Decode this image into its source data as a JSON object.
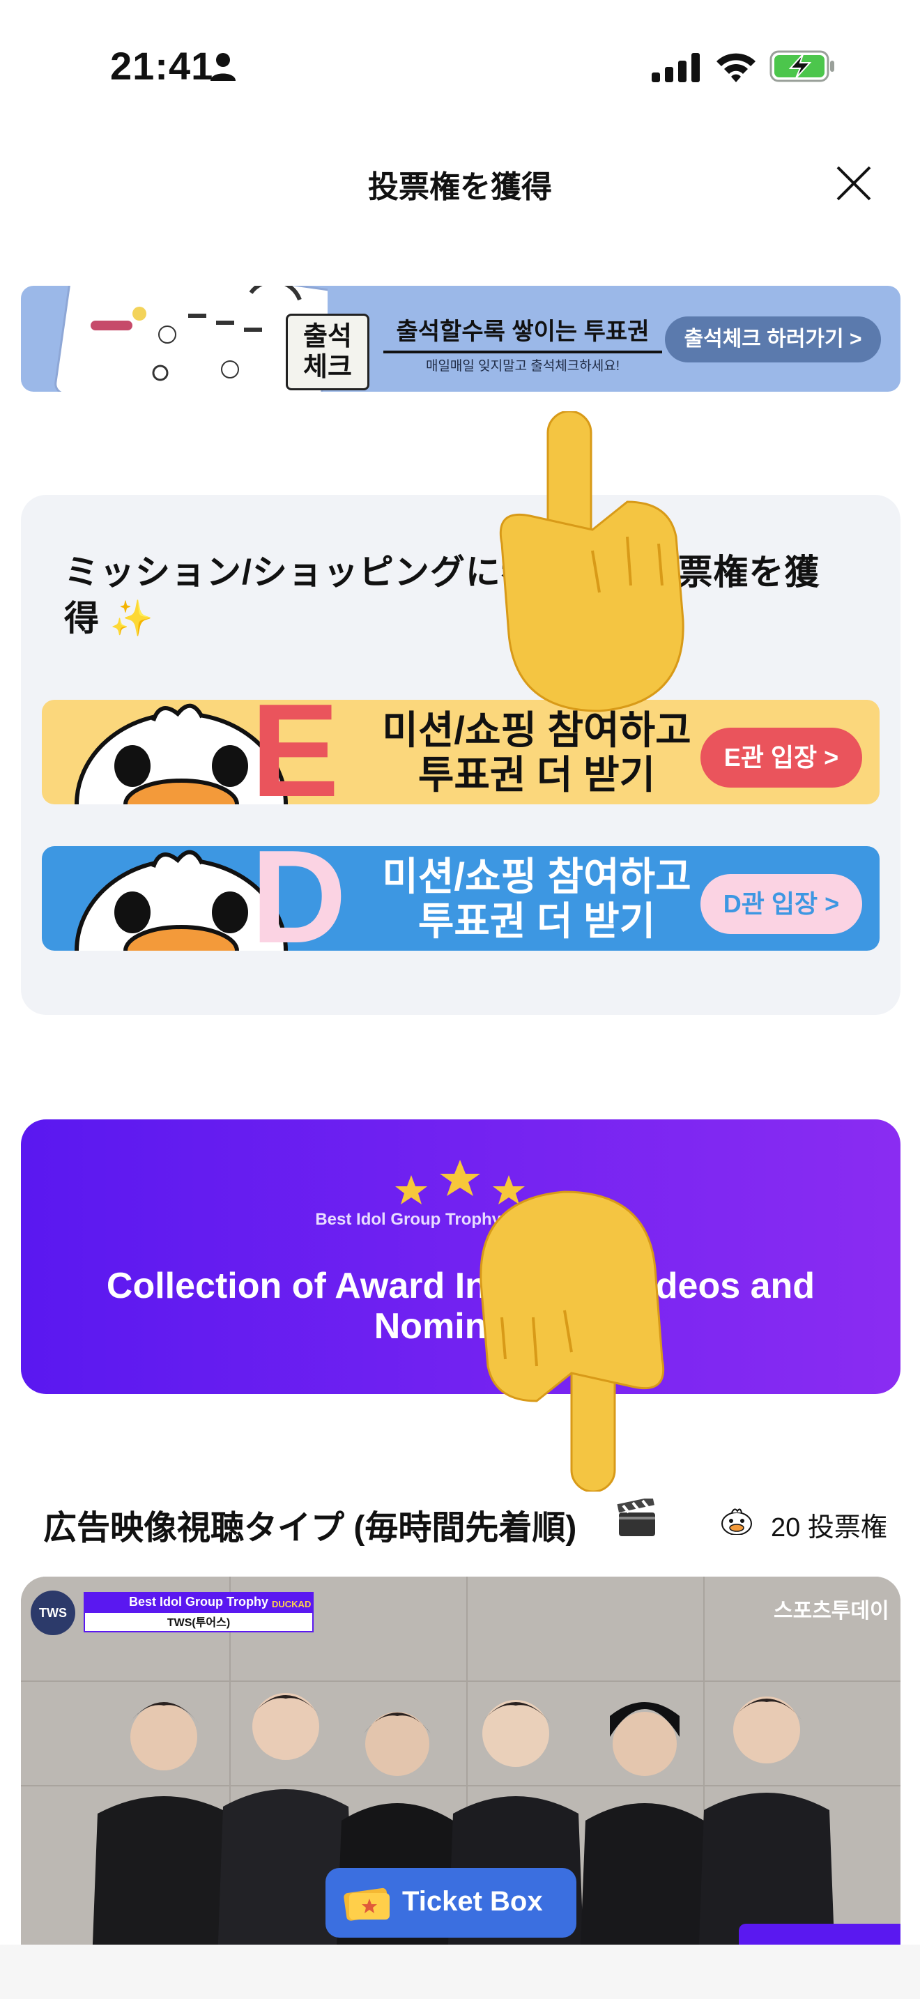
{
  "status_bar": {
    "time": "21:41"
  },
  "header": {
    "title": "投票権を獲得"
  },
  "attendance_banner": {
    "badge": "출석\n체크",
    "title": "출석할수록 쌓이는 투표권",
    "subtitle": "매일매일 잊지말고 출석체크하세요!",
    "button": "출석체크 하러가기 >"
  },
  "mission": {
    "title": "ミッション/ショッピングに参加して投票権を獲得 ✨",
    "e_store": {
      "letter": "E",
      "line1": "미션/쇼핑 참여하고",
      "line2": "투표권 더 받기",
      "button": "E관 입장 >"
    },
    "d_store": {
      "letter": "D",
      "line1": "미션/쇼핑 참여하고",
      "line2": "투표권 더 받기",
      "button": "D관 입장 >"
    }
  },
  "award_banner": {
    "subtitle": "Best Idol Group Trophy of the Month",
    "title": "Collection of Award Interview Videos and Nominees"
  },
  "ad_section": {
    "title": "広告映像視聴タイプ (毎時間先着順)",
    "votes": "20 投票権"
  },
  "video": {
    "logo": "TWS",
    "trophy": "Best Idol Group Trophy",
    "tag": "DUCKAD",
    "artist": "TWS(투어스)",
    "channel": "스포츠투데이"
  },
  "ticket_box": {
    "label": "Ticket Box"
  },
  "colors": {
    "purple": "#5a18f0",
    "yellow": "#fbd77c",
    "blue": "#3d97e2",
    "red": "#ea545c"
  }
}
